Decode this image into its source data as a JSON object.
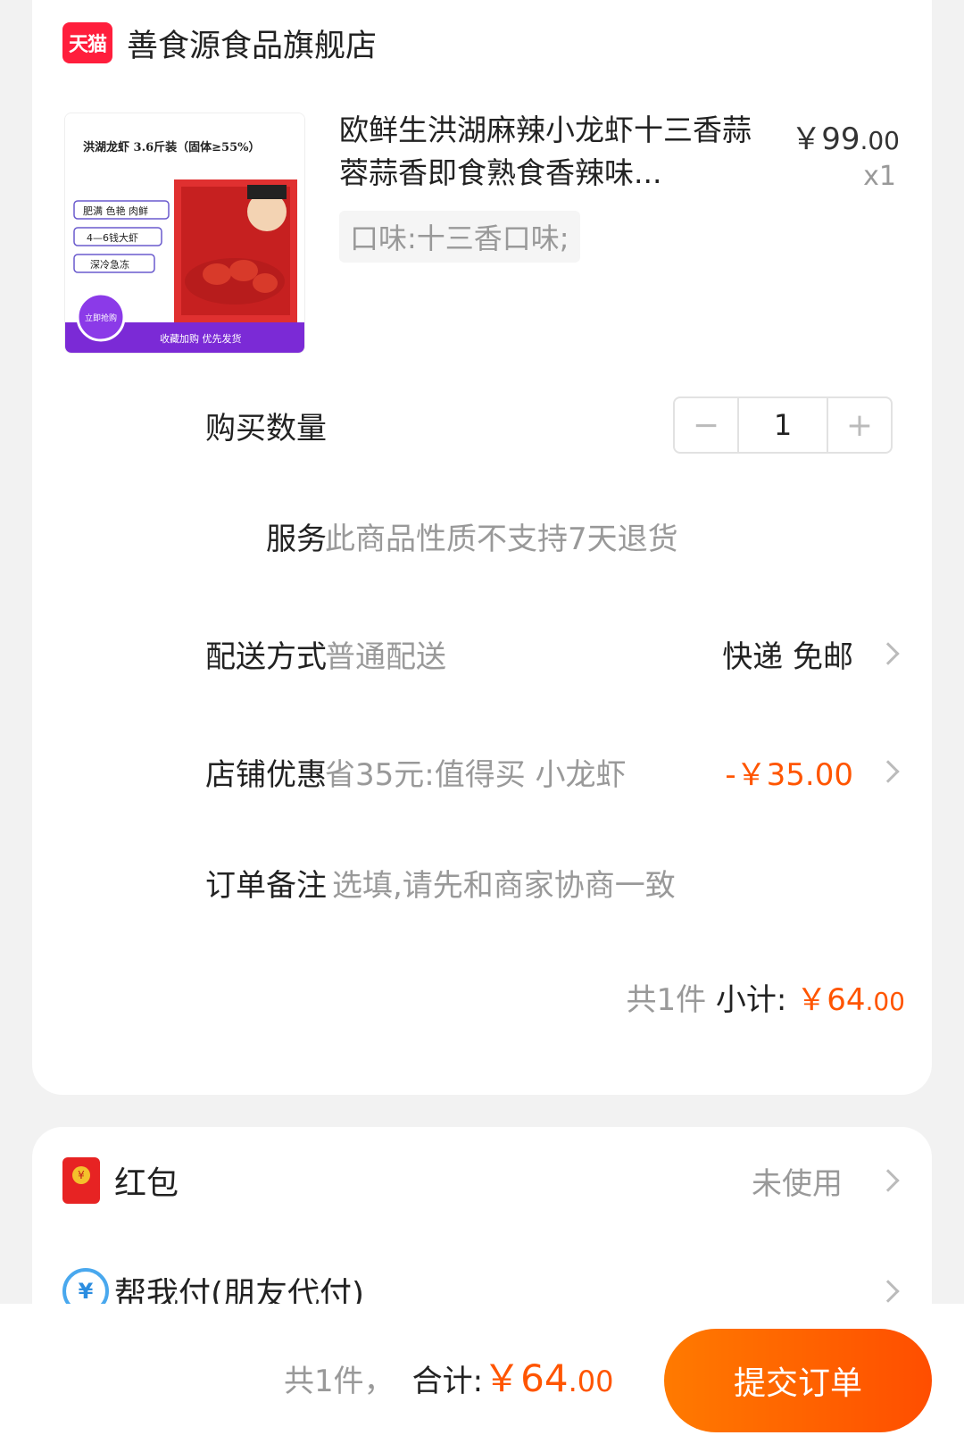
{
  "shop": {
    "logo_text": "天猫",
    "name": "善食源食品旗舰店"
  },
  "product": {
    "title": "欧鲜生洪湖麻辣小龙虾十三香蒜蓉蒜香即食熟食香辣味...",
    "price_main": "￥99",
    "price_decimal": ".00",
    "quantity": "x1",
    "flavor": "口味:十三香口味;",
    "image": {
      "headline": "洪湖龙虾 3.6斤装（固体≥55%）",
      "tags": [
        "肥满 色艳 肉鲜",
        "4—6钱大虾",
        "深冷急冻"
      ],
      "badge": "立即抢购",
      "footer": "收藏加购  优先发货"
    }
  },
  "rows": {
    "quantity_label": "购买数量",
    "quantity_value": "1",
    "minus": "−",
    "plus": "+",
    "service_label": "服务",
    "service_value": "此商品性质不支持7天退货",
    "delivery_label": "配送方式",
    "delivery_value": "普通配送",
    "delivery_right": "快递 免邮",
    "discount_label": "店铺优惠",
    "discount_value": "省35元:值得买 小龙虾",
    "discount_amount": "-￥35.00",
    "note_label": "订单备注",
    "note_placeholder": "选填,请先和商家协商一致"
  },
  "subtotal": {
    "count": "共1件",
    "label": "小计:",
    "amount_main": "￥64",
    "amount_decimal": ".00"
  },
  "extras": {
    "redpacket_label": "红包",
    "redpacket_value": "未使用",
    "payfor_label": "帮我付(朋友代付)",
    "payfor_icon": "¥"
  },
  "bottom": {
    "count": "共1件，",
    "label": "合计:",
    "amount_main": "￥64",
    "amount_decimal": ".00",
    "submit": "提交订单"
  },
  "colors": {
    "accent": "#ff5500",
    "tmall_red": "#ff1e3c"
  }
}
